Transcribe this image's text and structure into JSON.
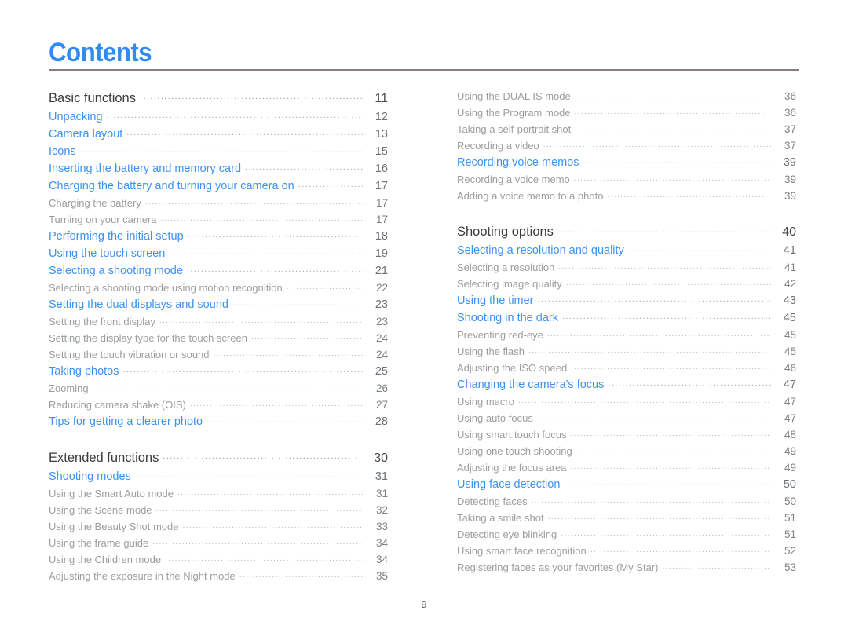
{
  "document": {
    "title": "Contents",
    "footer_page_number": "9",
    "accent_color": "#3d92f2",
    "rule_color": "#8a7d7e",
    "section_color": "#3b3b3b",
    "subentry_color": "#9b9ea1"
  },
  "columns": {
    "left": [
      {
        "level": "section",
        "label": "Basic functions",
        "page": "11"
      },
      {
        "level": 1,
        "label": "Unpacking",
        "page": "12"
      },
      {
        "level": 1,
        "label": "Camera layout",
        "page": "13"
      },
      {
        "level": 1,
        "label": "Icons",
        "page": "15"
      },
      {
        "level": 1,
        "label": "Inserting the battery and memory card",
        "page": "16"
      },
      {
        "level": 1,
        "label": "Charging the battery and turning your camera on",
        "page": "17"
      },
      {
        "level": 2,
        "label": "Charging the battery",
        "page": "17"
      },
      {
        "level": 2,
        "label": "Turning on your camera",
        "page": "17"
      },
      {
        "level": 1,
        "label": "Performing the initial setup",
        "page": "18"
      },
      {
        "level": 1,
        "label": "Using the touch screen",
        "page": "19"
      },
      {
        "level": 1,
        "label": "Selecting a shooting mode",
        "page": "21"
      },
      {
        "level": 2,
        "label": "Selecting a shooting mode using motion recognition",
        "page": "22"
      },
      {
        "level": 1,
        "label": "Setting the dual displays and sound",
        "page": "23"
      },
      {
        "level": 2,
        "label": "Setting the front display",
        "page": "23"
      },
      {
        "level": 2,
        "label": "Setting the display type for the touch screen",
        "page": "24"
      },
      {
        "level": 2,
        "label": "Setting the touch vibration or sound",
        "page": "24"
      },
      {
        "level": 1,
        "label": "Taking photos",
        "page": "25"
      },
      {
        "level": 2,
        "label": "Zooming",
        "page": "26"
      },
      {
        "level": 2,
        "label": "Reducing camera shake (OIS)",
        "page": "27"
      },
      {
        "level": 1,
        "label": "Tips for getting a clearer photo",
        "page": "28"
      },
      {
        "level": "section",
        "label": "Extended functions",
        "page": "30",
        "new_block": true
      },
      {
        "level": 1,
        "label": "Shooting modes",
        "page": "31"
      },
      {
        "level": 2,
        "label": "Using the Smart Auto mode",
        "page": "31"
      },
      {
        "level": 2,
        "label": "Using the Scene mode",
        "page": "32"
      },
      {
        "level": 2,
        "label": "Using the Beauty Shot mode",
        "page": "33"
      },
      {
        "level": 2,
        "label": "Using the frame guide",
        "page": "34"
      },
      {
        "level": 2,
        "label": "Using the Children mode",
        "page": "34"
      },
      {
        "level": 2,
        "label": "Adjusting the exposure in the Night mode",
        "page": "35"
      }
    ],
    "right": [
      {
        "level": 2,
        "label": "Using the DUAL IS mode",
        "page": "36"
      },
      {
        "level": 2,
        "label": "Using the Program mode",
        "page": "36"
      },
      {
        "level": 2,
        "label": "Taking a self-portrait shot",
        "page": "37"
      },
      {
        "level": 2,
        "label": "Recording a video",
        "page": "37"
      },
      {
        "level": 1,
        "label": "Recording voice memos",
        "page": "39"
      },
      {
        "level": 2,
        "label": "Recording a voice memo",
        "page": "39"
      },
      {
        "level": 2,
        "label": "Adding a voice memo to a photo",
        "page": "39"
      },
      {
        "level": "section",
        "label": "Shooting options",
        "page": "40",
        "new_block": true
      },
      {
        "level": 1,
        "label": "Selecting a resolution and quality",
        "page": "41"
      },
      {
        "level": 2,
        "label": "Selecting a resolution",
        "page": "41"
      },
      {
        "level": 2,
        "label": "Selecting image quality",
        "page": "42"
      },
      {
        "level": 1,
        "label": "Using the timer",
        "page": "43"
      },
      {
        "level": 1,
        "label": "Shooting in the dark",
        "page": "45"
      },
      {
        "level": 2,
        "label": "Preventing red-eye",
        "page": "45"
      },
      {
        "level": 2,
        "label": "Using the flash",
        "page": "45"
      },
      {
        "level": 2,
        "label": "Adjusting the ISO speed",
        "page": "46"
      },
      {
        "level": 1,
        "label": "Changing the camera's focus",
        "page": "47"
      },
      {
        "level": 2,
        "label": "Using macro",
        "page": "47"
      },
      {
        "level": 2,
        "label": "Using auto focus",
        "page": "47"
      },
      {
        "level": 2,
        "label": "Using smart touch focus",
        "page": "48"
      },
      {
        "level": 2,
        "label": "Using one touch shooting",
        "page": "49"
      },
      {
        "level": 2,
        "label": "Adjusting the focus area",
        "page": "49"
      },
      {
        "level": 1,
        "label": "Using face detection",
        "page": "50"
      },
      {
        "level": 2,
        "label": "Detecting faces",
        "page": "50"
      },
      {
        "level": 2,
        "label": "Taking a smile shot",
        "page": "51"
      },
      {
        "level": 2,
        "label": "Detecting eye blinking",
        "page": "51"
      },
      {
        "level": 2,
        "label": "Using smart face recognition",
        "page": "52"
      },
      {
        "level": 2,
        "label": "Registering faces as your favorites (My Star)",
        "page": "53"
      }
    ]
  }
}
